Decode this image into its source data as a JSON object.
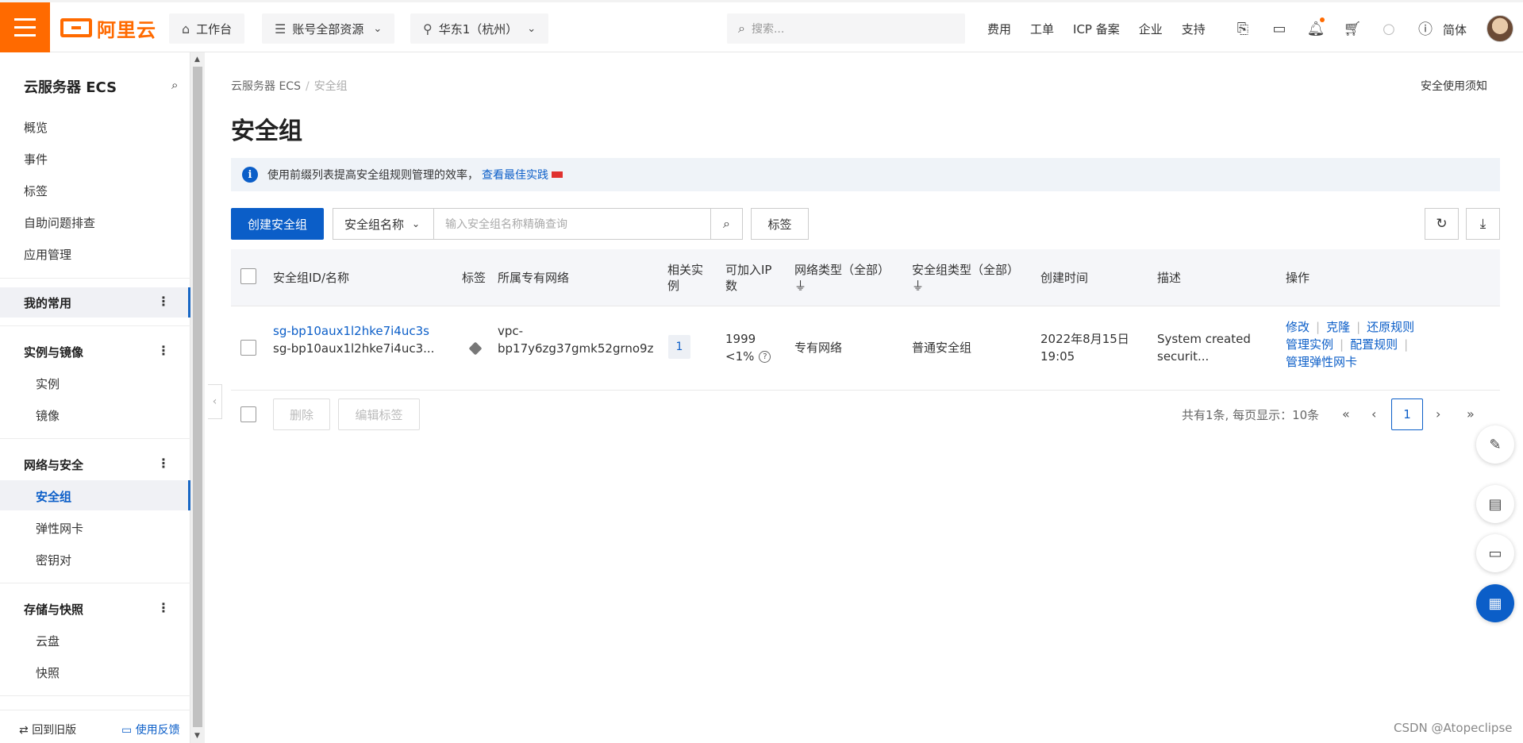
{
  "topbar": {
    "logo_text": "阿里云",
    "workbench": "工作台",
    "resources": "账号全部资源",
    "region": "华东1（杭州）",
    "search_placeholder": "搜索...",
    "links": [
      "费用",
      "工单",
      "ICP 备案",
      "企业",
      "支持"
    ],
    "language": "简体",
    "brand_color": "#ff6a00"
  },
  "sidebar": {
    "title": "云服务器 ECS",
    "top_items": [
      "概览",
      "事件",
      "标签",
      "自助问题排查",
      "应用管理"
    ],
    "favorites": "我的常用",
    "group_instances": "实例与镜像",
    "instances_items": [
      "实例",
      "镜像"
    ],
    "group_network": "网络与安全",
    "network_items": [
      "安全组",
      "弹性网卡",
      "密钥对"
    ],
    "group_storage": "存储与快照",
    "storage_items": [
      "云盘",
      "快照"
    ],
    "footer_back": "回到旧版",
    "footer_feedback": "使用反馈"
  },
  "main": {
    "breadcrumb_root": "云服务器 ECS",
    "breadcrumb_current": "安全组",
    "notice": "安全使用须知",
    "title": "安全组",
    "tip_text": "使用前缀列表提高安全组规则管理的效率，",
    "tip_link": "查看最佳实践",
    "create_button": "创建安全组",
    "filter_select": "安全组名称",
    "filter_placeholder": "输入安全组名称精确查询",
    "tag_button": "标签",
    "accent_color": "#0b5ec8"
  },
  "table": {
    "headers": {
      "id_name": "安全组ID/名称",
      "tag": "标签",
      "vpc": "所属专有网络",
      "instances_1": "相关实",
      "instances_2": "例",
      "ip_1": "可加入IP",
      "ip_2": "数",
      "net_type": "网络类型（全部）",
      "sg_type": "安全组类型（全部）",
      "created": "创建时间",
      "desc": "描述",
      "ops": "操作"
    },
    "row": {
      "id": "sg-bp10aux1l2hke7i4uc3s",
      "name": "sg-bp10aux1l2hke7i4uc3...",
      "vpc_1": "vpc-",
      "vpc_2": "bp17y6zg37gmk52grno9z",
      "instances": "1",
      "ip_count": "1999",
      "ip_pct": "<1%",
      "net_type": "专有网络",
      "sg_type": "普通安全组",
      "created_date": "2022年8月15日",
      "created_time": "19:05",
      "desc_1": "System created",
      "desc_2": "securit...",
      "ops": {
        "modify": "修改",
        "clone": "克隆",
        "restore": "还原规则",
        "manage_instances": "管理实例",
        "config_rules": "配置规则",
        "manage_eni": "管理弹性网卡"
      }
    }
  },
  "footer": {
    "delete": "删除",
    "edit_tags": "编辑标签",
    "summary": "共有1条, 每页显示：10条",
    "current_page": "1"
  },
  "watermark": "CSDN @Atopeclipse"
}
